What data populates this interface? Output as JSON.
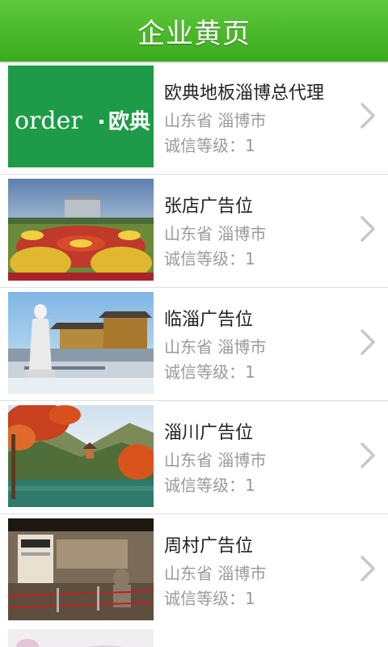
{
  "header": {
    "title": "企业黄页"
  },
  "colors": {
    "header": "#4cbb2c",
    "title": "#222222",
    "meta": "#9a9a9a",
    "chevron": "#c8c8c8"
  },
  "listings": [
    {
      "title": "欧典地板淄博总代理",
      "location": "山东省 淄博市",
      "credit": "诚信等级：1",
      "logo_text": "order",
      "logo_brand": "欧典",
      "image": "order-logo"
    },
    {
      "title": "张店广告位",
      "location": "山东省 淄博市",
      "credit": "诚信等级：1",
      "image": "flower-garden-photo"
    },
    {
      "title": "临淄广告位",
      "location": "山东省 淄博市",
      "credit": "诚信等级：1",
      "image": "statue-temple-photo"
    },
    {
      "title": "淄川广告位",
      "location": "山东省 淄博市",
      "credit": "诚信等级：1",
      "image": "autumn-lake-photo"
    },
    {
      "title": "周村广告位",
      "location": "山东省 淄博市",
      "credit": "诚信等级：1",
      "image": "museum-exhibit-photo"
    }
  ]
}
